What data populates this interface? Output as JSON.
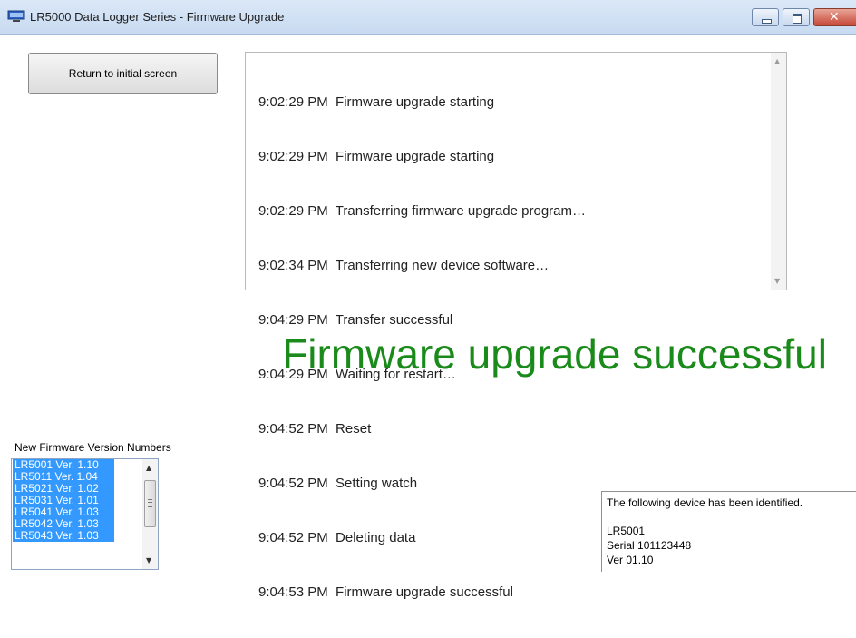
{
  "window": {
    "title": "LR5000 Data Logger Series - Firmware Upgrade"
  },
  "buttons": {
    "return_label": "Return to initial screen"
  },
  "log": {
    "lines": [
      "9:02:29 PM  Firmware upgrade starting",
      "9:02:29 PM  Firmware upgrade starting",
      "9:02:29 PM  Transferring firmware upgrade program…",
      "9:02:34 PM  Transferring new device software…",
      "9:04:29 PM  Transfer successful",
      "9:04:29 PM  Waiting for restart…",
      "9:04:52 PM  Reset",
      "9:04:52 PM  Setting watch",
      "9:04:52 PM  Deleting data",
      "9:04:53 PM  Firmware upgrade successful"
    ]
  },
  "status": {
    "message": "Firmware upgrade successful",
    "color": "#1a8a1a"
  },
  "firmware": {
    "label": "New Firmware Version Numbers",
    "items": [
      "LR5001 Ver. 1.10",
      "LR5011 Ver. 1.04",
      "LR5021 Ver. 1.02",
      "LR5031 Ver. 1.01",
      "LR5041 Ver. 1.03",
      "LR5042 Ver. 1.03",
      "LR5043 Ver. 1.03"
    ]
  },
  "device": {
    "heading": "The following device has been identified.",
    "model": "LR5001",
    "serial": "Serial 101123448",
    "version": "Ver 01.10"
  },
  "icons": {
    "app": "computer-monitor-icon",
    "minimize": "minimize-icon",
    "maximize": "maximize-icon",
    "close": "close-icon",
    "scroll_up": "scroll-up-arrow-icon",
    "scroll_down": "scroll-down-arrow-icon"
  }
}
